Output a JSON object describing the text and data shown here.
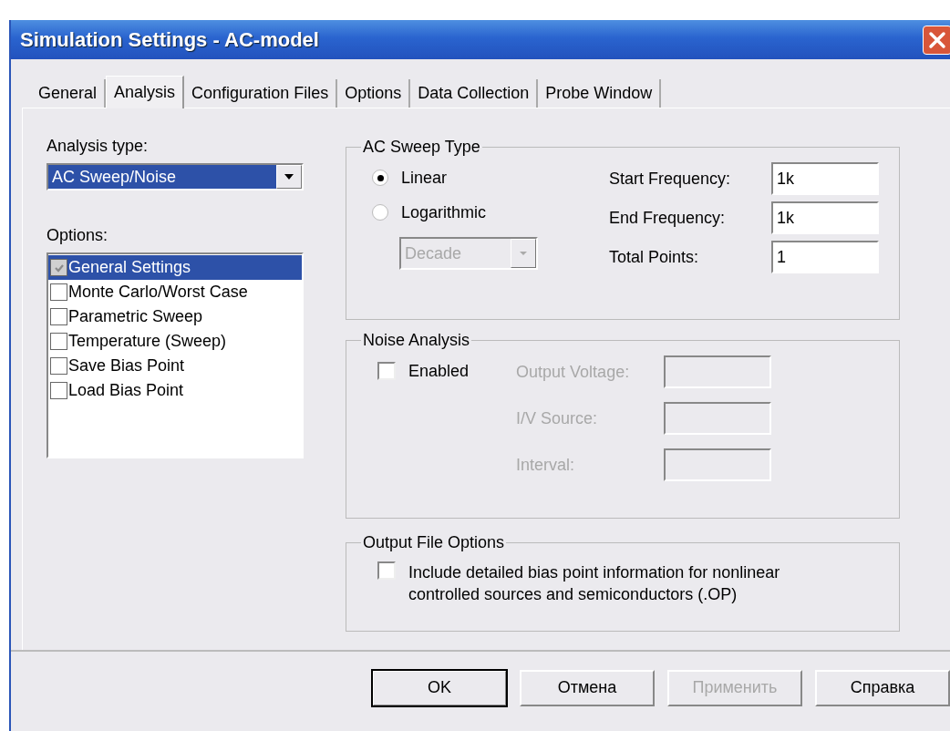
{
  "window": {
    "title": "Simulation Settings - AC-model"
  },
  "tabs": [
    {
      "label": "General",
      "selected": false
    },
    {
      "label": "Analysis",
      "selected": true
    },
    {
      "label": "Configuration Files",
      "selected": false
    },
    {
      "label": "Options",
      "selected": false
    },
    {
      "label": "Data Collection",
      "selected": false
    },
    {
      "label": "Probe Window",
      "selected": false
    }
  ],
  "analysis_type": {
    "label": "Analysis type:",
    "value": "AC Sweep/Noise"
  },
  "options": {
    "label": "Options:",
    "items": [
      {
        "label": "General Settings",
        "checked": true,
        "disabled": true,
        "selected": true
      },
      {
        "label": "Monte Carlo/Worst Case",
        "checked": false,
        "disabled": false,
        "selected": false
      },
      {
        "label": "Parametric Sweep",
        "checked": false,
        "disabled": false,
        "selected": false
      },
      {
        "label": "Temperature (Sweep)",
        "checked": false,
        "disabled": false,
        "selected": false
      },
      {
        "label": "Save Bias Point",
        "checked": false,
        "disabled": false,
        "selected": false
      },
      {
        "label": "Load Bias Point",
        "checked": false,
        "disabled": false,
        "selected": false
      }
    ]
  },
  "ac_sweep_type": {
    "title": "AC Sweep Type",
    "modes": [
      {
        "label": "Linear",
        "selected": true
      },
      {
        "label": "Logarithmic",
        "selected": false
      }
    ],
    "scale": {
      "value": "Decade",
      "disabled": true
    },
    "fields": [
      {
        "label": "Start Frequency:",
        "value": "1k"
      },
      {
        "label": "End Frequency:",
        "value": "1k"
      },
      {
        "label": "Total Points:",
        "value": "1"
      }
    ]
  },
  "noise_analysis": {
    "title": "Noise Analysis",
    "enabled": {
      "label": "Enabled",
      "checked": false
    },
    "fields": [
      {
        "label": "Output Voltage:",
        "disabled": true
      },
      {
        "label": "I/V Source:",
        "disabled": true
      },
      {
        "label": "Interval:",
        "disabled": true
      }
    ]
  },
  "output_file_options": {
    "title": "Output File Options",
    "option": {
      "label": "Include detailed bias point information for nonlinear\ncontrolled sources and semiconductors (.OP)",
      "checked": false
    }
  },
  "buttons": [
    {
      "label": "OK",
      "default": true,
      "disabled": false
    },
    {
      "label": "Отмена",
      "default": false,
      "disabled": false
    },
    {
      "label": "Применить",
      "default": false,
      "disabled": true
    },
    {
      "label": "Справка",
      "default": false,
      "disabled": false
    }
  ]
}
